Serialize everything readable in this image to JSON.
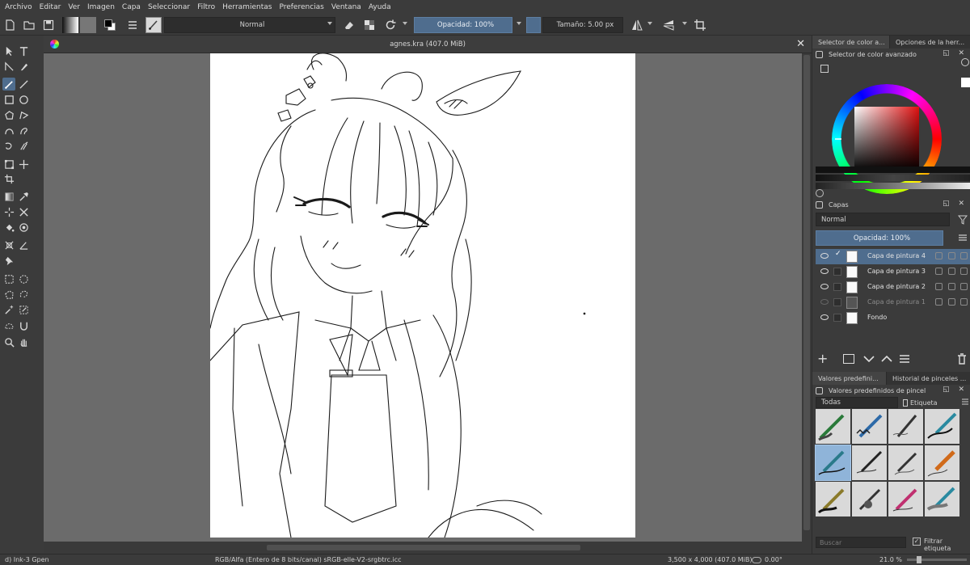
{
  "menu": [
    "Archivo",
    "Editar",
    "Ver",
    "Imagen",
    "Capa",
    "Seleccionar",
    "Filtro",
    "Herramientas",
    "Preferencias",
    "Ventana",
    "Ayuda"
  ],
  "toolbar": {
    "blend_mode": "Normal",
    "opacity": "Opacidad: 100%",
    "size": "Tamaño: 5.00 px"
  },
  "document": {
    "tab_title": "agnes.kra (407.0 MiB)",
    "close": "✕"
  },
  "docker": {
    "top_tabs": [
      "Selector de color a...",
      "Opciones de la herr..."
    ],
    "color_selector_title": "Selector de color avanzado",
    "layers_title": "Capas",
    "layers_blend": "Normal",
    "layers_opacity": "Opacidad:  100%",
    "layers": [
      {
        "name": "Capa de pintura 4",
        "visible": true,
        "selected": true
      },
      {
        "name": "Capa de pintura 3",
        "visible": true,
        "selected": false
      },
      {
        "name": "Capa de pintura 2",
        "visible": true,
        "selected": false
      },
      {
        "name": "Capa de pintura 1",
        "visible": false,
        "selected": false
      },
      {
        "name": "Fondo",
        "visible": true,
        "selected": false
      }
    ],
    "brush_tabs": [
      "Valores predefini...",
      "Historial de pinceles ..."
    ],
    "brush_title": "Valores predefinidos de pincel",
    "brush_filter": "Todas",
    "brush_tag": "Etiqueta",
    "search_placeholder": "Buscar",
    "filter_tag_label": "Filtrar etiqueta"
  },
  "status": {
    "brush": "d) Ink-3 Gpen",
    "color_space": "RGB/Alfa (Entero de 8 bits/canal)  sRGB-elle-V2-srgbtrc.icc",
    "dimensions": "3,500 x 4,000 (407.0 MiB)",
    "rotation": "0.00°",
    "zoom": "21.0 %"
  },
  "colors": {
    "accent": "#4f6d8e",
    "panel": "#3b3b3b",
    "canvas_bg": "#6b6b6b"
  }
}
